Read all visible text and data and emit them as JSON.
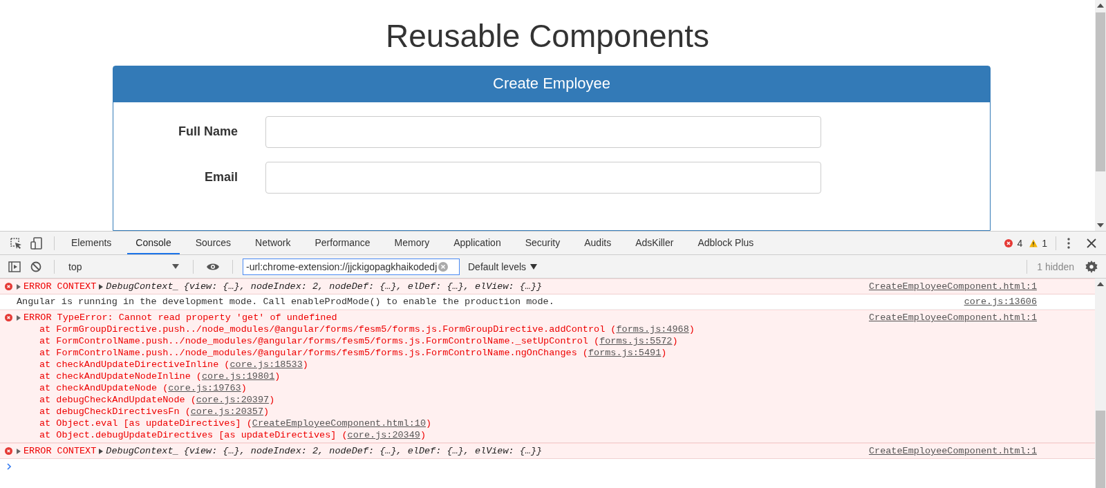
{
  "page": {
    "title": "Reusable Components",
    "panel": {
      "heading": "Create Employee",
      "fields": [
        {
          "label": "Full Name"
        },
        {
          "label": "Email"
        }
      ]
    }
  },
  "devtools": {
    "tabs": [
      {
        "label": "Elements",
        "selected": false
      },
      {
        "label": "Console",
        "selected": true
      },
      {
        "label": "Sources",
        "selected": false
      },
      {
        "label": "Network",
        "selected": false
      },
      {
        "label": "Performance",
        "selected": false
      },
      {
        "label": "Memory",
        "selected": false
      },
      {
        "label": "Application",
        "selected": false
      },
      {
        "label": "Security",
        "selected": false
      },
      {
        "label": "Audits",
        "selected": false
      },
      {
        "label": "AdsKiller",
        "selected": false
      },
      {
        "label": "Adblock Plus",
        "selected": false
      }
    ],
    "error_count": "4",
    "warning_count": "1",
    "toolbar": {
      "context": "top",
      "filter": "-url:chrome-extension://jjckigopagkhaikodedj",
      "levels": "Default levels",
      "hidden": "1 hidden"
    },
    "messages": [
      {
        "kind": "error",
        "text": "ERROR CONTEXT",
        "object_class": "DebugContext_",
        "object_preview": "{view: {…}, nodeIndex: 2, nodeDef: {…}, elDef: {…}, elView: {…}}",
        "source": "CreateEmployeeComponent.html:1"
      },
      {
        "kind": "info",
        "text": "Angular is running in the development mode. Call enableProdMode() to enable the production mode.",
        "source": "core.js:13606"
      },
      {
        "kind": "error",
        "text": "ERROR TypeError: Cannot read property 'get' of undefined",
        "source": "CreateEmployeeComponent.html:1",
        "frames": [
          {
            "text": "at FormGroupDirective.push../node_modules/@angular/forms/fesm5/forms.js.FormGroupDirective.addControl (",
            "link": "forms.js:4968",
            "end": ")"
          },
          {
            "text": "at FormControlName.push../node_modules/@angular/forms/fesm5/forms.js.FormControlName._setUpControl (",
            "link": "forms.js:5572",
            "end": ")"
          },
          {
            "text": "at FormControlName.push../node_modules/@angular/forms/fesm5/forms.js.FormControlName.ngOnChanges (",
            "link": "forms.js:5491",
            "end": ")"
          },
          {
            "text": "at checkAndUpdateDirectiveInline (",
            "link": "core.js:18533",
            "end": ")"
          },
          {
            "text": "at checkAndUpdateNodeInline (",
            "link": "core.js:19801",
            "end": ")"
          },
          {
            "text": "at checkAndUpdateNode (",
            "link": "core.js:19763",
            "end": ")"
          },
          {
            "text": "at debugCheckAndUpdateNode (",
            "link": "core.js:20397",
            "end": ")"
          },
          {
            "text": "at debugCheckDirectivesFn (",
            "link": "core.js:20357",
            "end": ")"
          },
          {
            "text": "at Object.eval [as updateDirectives] (",
            "link": "CreateEmployeeComponent.html:10",
            "end": ")"
          },
          {
            "text": "at Object.debugUpdateDirectives [as updateDirectives] (",
            "link": "core.js:20349",
            "end": ")"
          }
        ]
      },
      {
        "kind": "error",
        "text": "ERROR CONTEXT",
        "object_class": "DebugContext_",
        "object_preview": "{view: {…}, nodeIndex: 2, nodeDef: {…}, elDef: {…}, elView: {…}}",
        "source": "CreateEmployeeComponent.html:1"
      }
    ]
  }
}
